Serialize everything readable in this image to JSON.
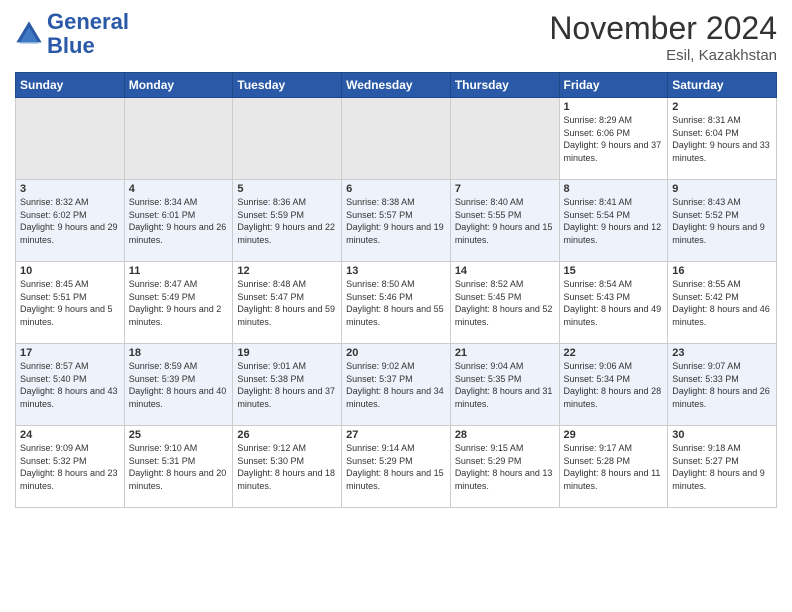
{
  "header": {
    "logo_line1": "General",
    "logo_line2": "Blue",
    "month_title": "November 2024",
    "location": "Esil, Kazakhstan"
  },
  "weekdays": [
    "Sunday",
    "Monday",
    "Tuesday",
    "Wednesday",
    "Thursday",
    "Friday",
    "Saturday"
  ],
  "weeks": [
    [
      {
        "day": "",
        "info": ""
      },
      {
        "day": "",
        "info": ""
      },
      {
        "day": "",
        "info": ""
      },
      {
        "day": "",
        "info": ""
      },
      {
        "day": "",
        "info": ""
      },
      {
        "day": "1",
        "info": "Sunrise: 8:29 AM\nSunset: 6:06 PM\nDaylight: 9 hours and 37 minutes."
      },
      {
        "day": "2",
        "info": "Sunrise: 8:31 AM\nSunset: 6:04 PM\nDaylight: 9 hours and 33 minutes."
      }
    ],
    [
      {
        "day": "3",
        "info": "Sunrise: 8:32 AM\nSunset: 6:02 PM\nDaylight: 9 hours and 29 minutes."
      },
      {
        "day": "4",
        "info": "Sunrise: 8:34 AM\nSunset: 6:01 PM\nDaylight: 9 hours and 26 minutes."
      },
      {
        "day": "5",
        "info": "Sunrise: 8:36 AM\nSunset: 5:59 PM\nDaylight: 9 hours and 22 minutes."
      },
      {
        "day": "6",
        "info": "Sunrise: 8:38 AM\nSunset: 5:57 PM\nDaylight: 9 hours and 19 minutes."
      },
      {
        "day": "7",
        "info": "Sunrise: 8:40 AM\nSunset: 5:55 PM\nDaylight: 9 hours and 15 minutes."
      },
      {
        "day": "8",
        "info": "Sunrise: 8:41 AM\nSunset: 5:54 PM\nDaylight: 9 hours and 12 minutes."
      },
      {
        "day": "9",
        "info": "Sunrise: 8:43 AM\nSunset: 5:52 PM\nDaylight: 9 hours and 9 minutes."
      }
    ],
    [
      {
        "day": "10",
        "info": "Sunrise: 8:45 AM\nSunset: 5:51 PM\nDaylight: 9 hours and 5 minutes."
      },
      {
        "day": "11",
        "info": "Sunrise: 8:47 AM\nSunset: 5:49 PM\nDaylight: 9 hours and 2 minutes."
      },
      {
        "day": "12",
        "info": "Sunrise: 8:48 AM\nSunset: 5:47 PM\nDaylight: 8 hours and 59 minutes."
      },
      {
        "day": "13",
        "info": "Sunrise: 8:50 AM\nSunset: 5:46 PM\nDaylight: 8 hours and 55 minutes."
      },
      {
        "day": "14",
        "info": "Sunrise: 8:52 AM\nSunset: 5:45 PM\nDaylight: 8 hours and 52 minutes."
      },
      {
        "day": "15",
        "info": "Sunrise: 8:54 AM\nSunset: 5:43 PM\nDaylight: 8 hours and 49 minutes."
      },
      {
        "day": "16",
        "info": "Sunrise: 8:55 AM\nSunset: 5:42 PM\nDaylight: 8 hours and 46 minutes."
      }
    ],
    [
      {
        "day": "17",
        "info": "Sunrise: 8:57 AM\nSunset: 5:40 PM\nDaylight: 8 hours and 43 minutes."
      },
      {
        "day": "18",
        "info": "Sunrise: 8:59 AM\nSunset: 5:39 PM\nDaylight: 8 hours and 40 minutes."
      },
      {
        "day": "19",
        "info": "Sunrise: 9:01 AM\nSunset: 5:38 PM\nDaylight: 8 hours and 37 minutes."
      },
      {
        "day": "20",
        "info": "Sunrise: 9:02 AM\nSunset: 5:37 PM\nDaylight: 8 hours and 34 minutes."
      },
      {
        "day": "21",
        "info": "Sunrise: 9:04 AM\nSunset: 5:35 PM\nDaylight: 8 hours and 31 minutes."
      },
      {
        "day": "22",
        "info": "Sunrise: 9:06 AM\nSunset: 5:34 PM\nDaylight: 8 hours and 28 minutes."
      },
      {
        "day": "23",
        "info": "Sunrise: 9:07 AM\nSunset: 5:33 PM\nDaylight: 8 hours and 26 minutes."
      }
    ],
    [
      {
        "day": "24",
        "info": "Sunrise: 9:09 AM\nSunset: 5:32 PM\nDaylight: 8 hours and 23 minutes."
      },
      {
        "day": "25",
        "info": "Sunrise: 9:10 AM\nSunset: 5:31 PM\nDaylight: 8 hours and 20 minutes."
      },
      {
        "day": "26",
        "info": "Sunrise: 9:12 AM\nSunset: 5:30 PM\nDaylight: 8 hours and 18 minutes."
      },
      {
        "day": "27",
        "info": "Sunrise: 9:14 AM\nSunset: 5:29 PM\nDaylight: 8 hours and 15 minutes."
      },
      {
        "day": "28",
        "info": "Sunrise: 9:15 AM\nSunset: 5:29 PM\nDaylight: 8 hours and 13 minutes."
      },
      {
        "day": "29",
        "info": "Sunrise: 9:17 AM\nSunset: 5:28 PM\nDaylight: 8 hours and 11 minutes."
      },
      {
        "day": "30",
        "info": "Sunrise: 9:18 AM\nSunset: 5:27 PM\nDaylight: 8 hours and 9 minutes."
      }
    ]
  ]
}
